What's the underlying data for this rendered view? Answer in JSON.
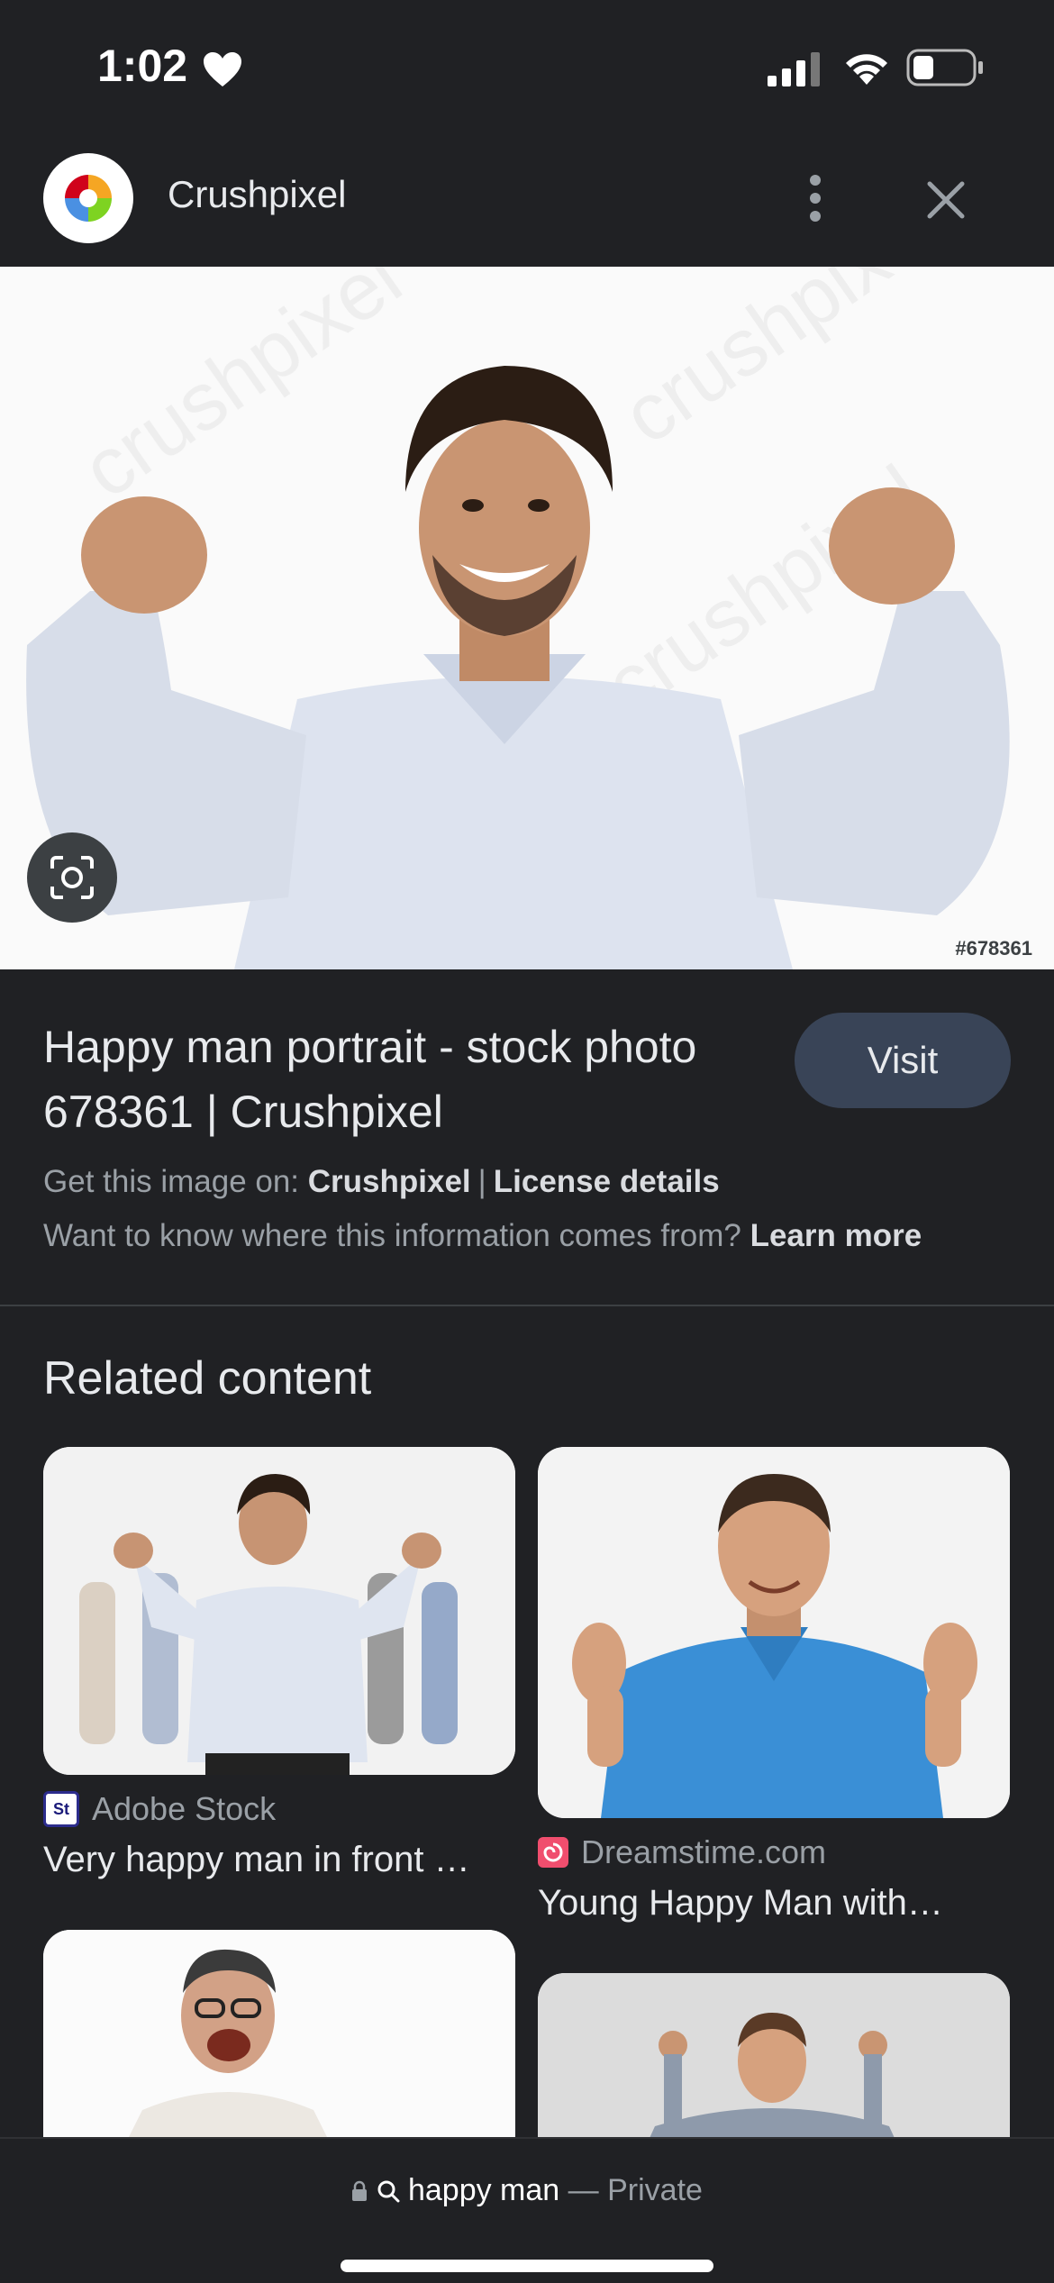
{
  "status": {
    "time": "1:02",
    "battery_level": 0.35
  },
  "header": {
    "site_name": "Crushpixel",
    "logo_icon": "crushpixel-logo-icon",
    "more_icon": "more-vert-icon",
    "close_icon": "close-icon"
  },
  "hero": {
    "image_id": "#678361",
    "lens_icon": "lens-icon"
  },
  "info": {
    "title": "Happy man portrait - stock photo 678361 | Crushpixel",
    "visit_label": "Visit",
    "get_image_prefix": "Get this image on:",
    "get_image_source": "Crushpixel",
    "separator": "|",
    "license_link": "License details",
    "info_question": "Want to know where this information comes from?",
    "learn_more": "Learn more"
  },
  "related": {
    "heading": "Related content",
    "items": [
      {
        "source": "Adobe Stock",
        "source_icon": "adobe-stock-icon",
        "title": "Very happy man in front …"
      },
      {
        "source": "Dreamstime.com",
        "source_icon": "dreamstime-icon",
        "title": "Young Happy Man with…"
      },
      {
        "source": "",
        "source_icon": "",
        "title": ""
      },
      {
        "source": "",
        "source_icon": "",
        "title": ""
      }
    ]
  },
  "bottom": {
    "query": "happy man",
    "mode": "— Private",
    "lock_icon": "lock-icon",
    "search_icon": "search-icon"
  },
  "colors": {
    "background": "#202124",
    "visit_button": "#394457",
    "accent_text": "#e8eaed",
    "muted_text": "#9aa0a6"
  }
}
